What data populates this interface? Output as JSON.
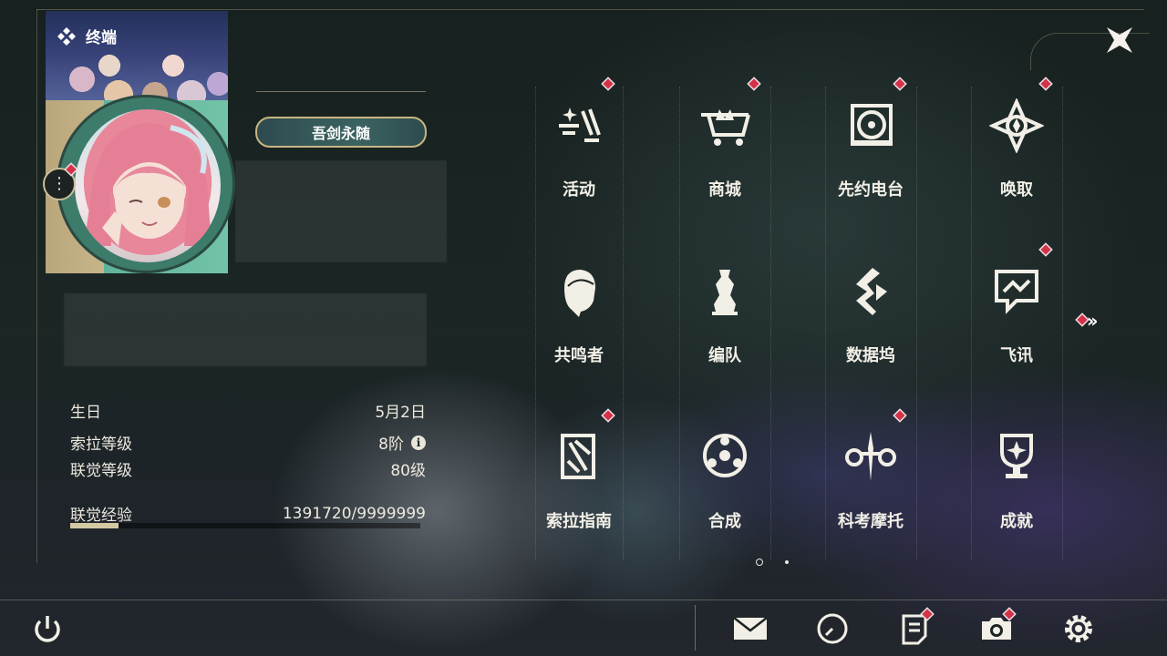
{
  "header": {
    "terminal_label": "终端"
  },
  "profile": {
    "title_badge": "吾剑永随",
    "stats": [
      {
        "label": "生日",
        "value": "5月2日"
      },
      {
        "label": "索拉等级",
        "value": "8阶"
      },
      {
        "label": "联觉等级",
        "value": "80级"
      },
      {
        "label": "联觉经验",
        "value": "1391720/9999999"
      }
    ],
    "exp_fraction": 0.139
  },
  "menu": [
    {
      "label": "活动",
      "icon": "activity-icon",
      "badge": true
    },
    {
      "label": "商城",
      "icon": "shop-cart-icon",
      "badge": true
    },
    {
      "label": "先约电台",
      "icon": "radio-icon",
      "badge": true
    },
    {
      "label": "唤取",
      "icon": "summon-compass-icon",
      "badge": true
    },
    {
      "label": "共鸣者",
      "icon": "resonator-portrait-icon",
      "badge": false
    },
    {
      "label": "编队",
      "icon": "chess-team-icon",
      "badge": false
    },
    {
      "label": "数据坞",
      "icon": "data-dock-icon",
      "badge": false
    },
    {
      "label": "飞讯",
      "icon": "message-icon",
      "badge": true
    },
    {
      "label": "索拉指南",
      "icon": "guide-book-icon",
      "badge": true
    },
    {
      "label": "合成",
      "icon": "synthesis-icon",
      "badge": false
    },
    {
      "label": "科考摩托",
      "icon": "motorbike-icon",
      "badge": true
    },
    {
      "label": "成就",
      "icon": "trophy-icon",
      "badge": false
    }
  ],
  "pagination": {
    "current": 1,
    "total": 2
  },
  "bottom_bar": [
    {
      "icon": "mail-icon",
      "badge": false
    },
    {
      "icon": "clock-icon",
      "badge": false
    },
    {
      "icon": "notice-icon",
      "badge": true
    },
    {
      "icon": "camera-icon",
      "badge": true
    },
    {
      "icon": "settings-gear-icon",
      "badge": false
    }
  ],
  "colors": {
    "badge": "#d2334a",
    "accent_gold": "#c9b682",
    "text": "#f1efe6"
  }
}
